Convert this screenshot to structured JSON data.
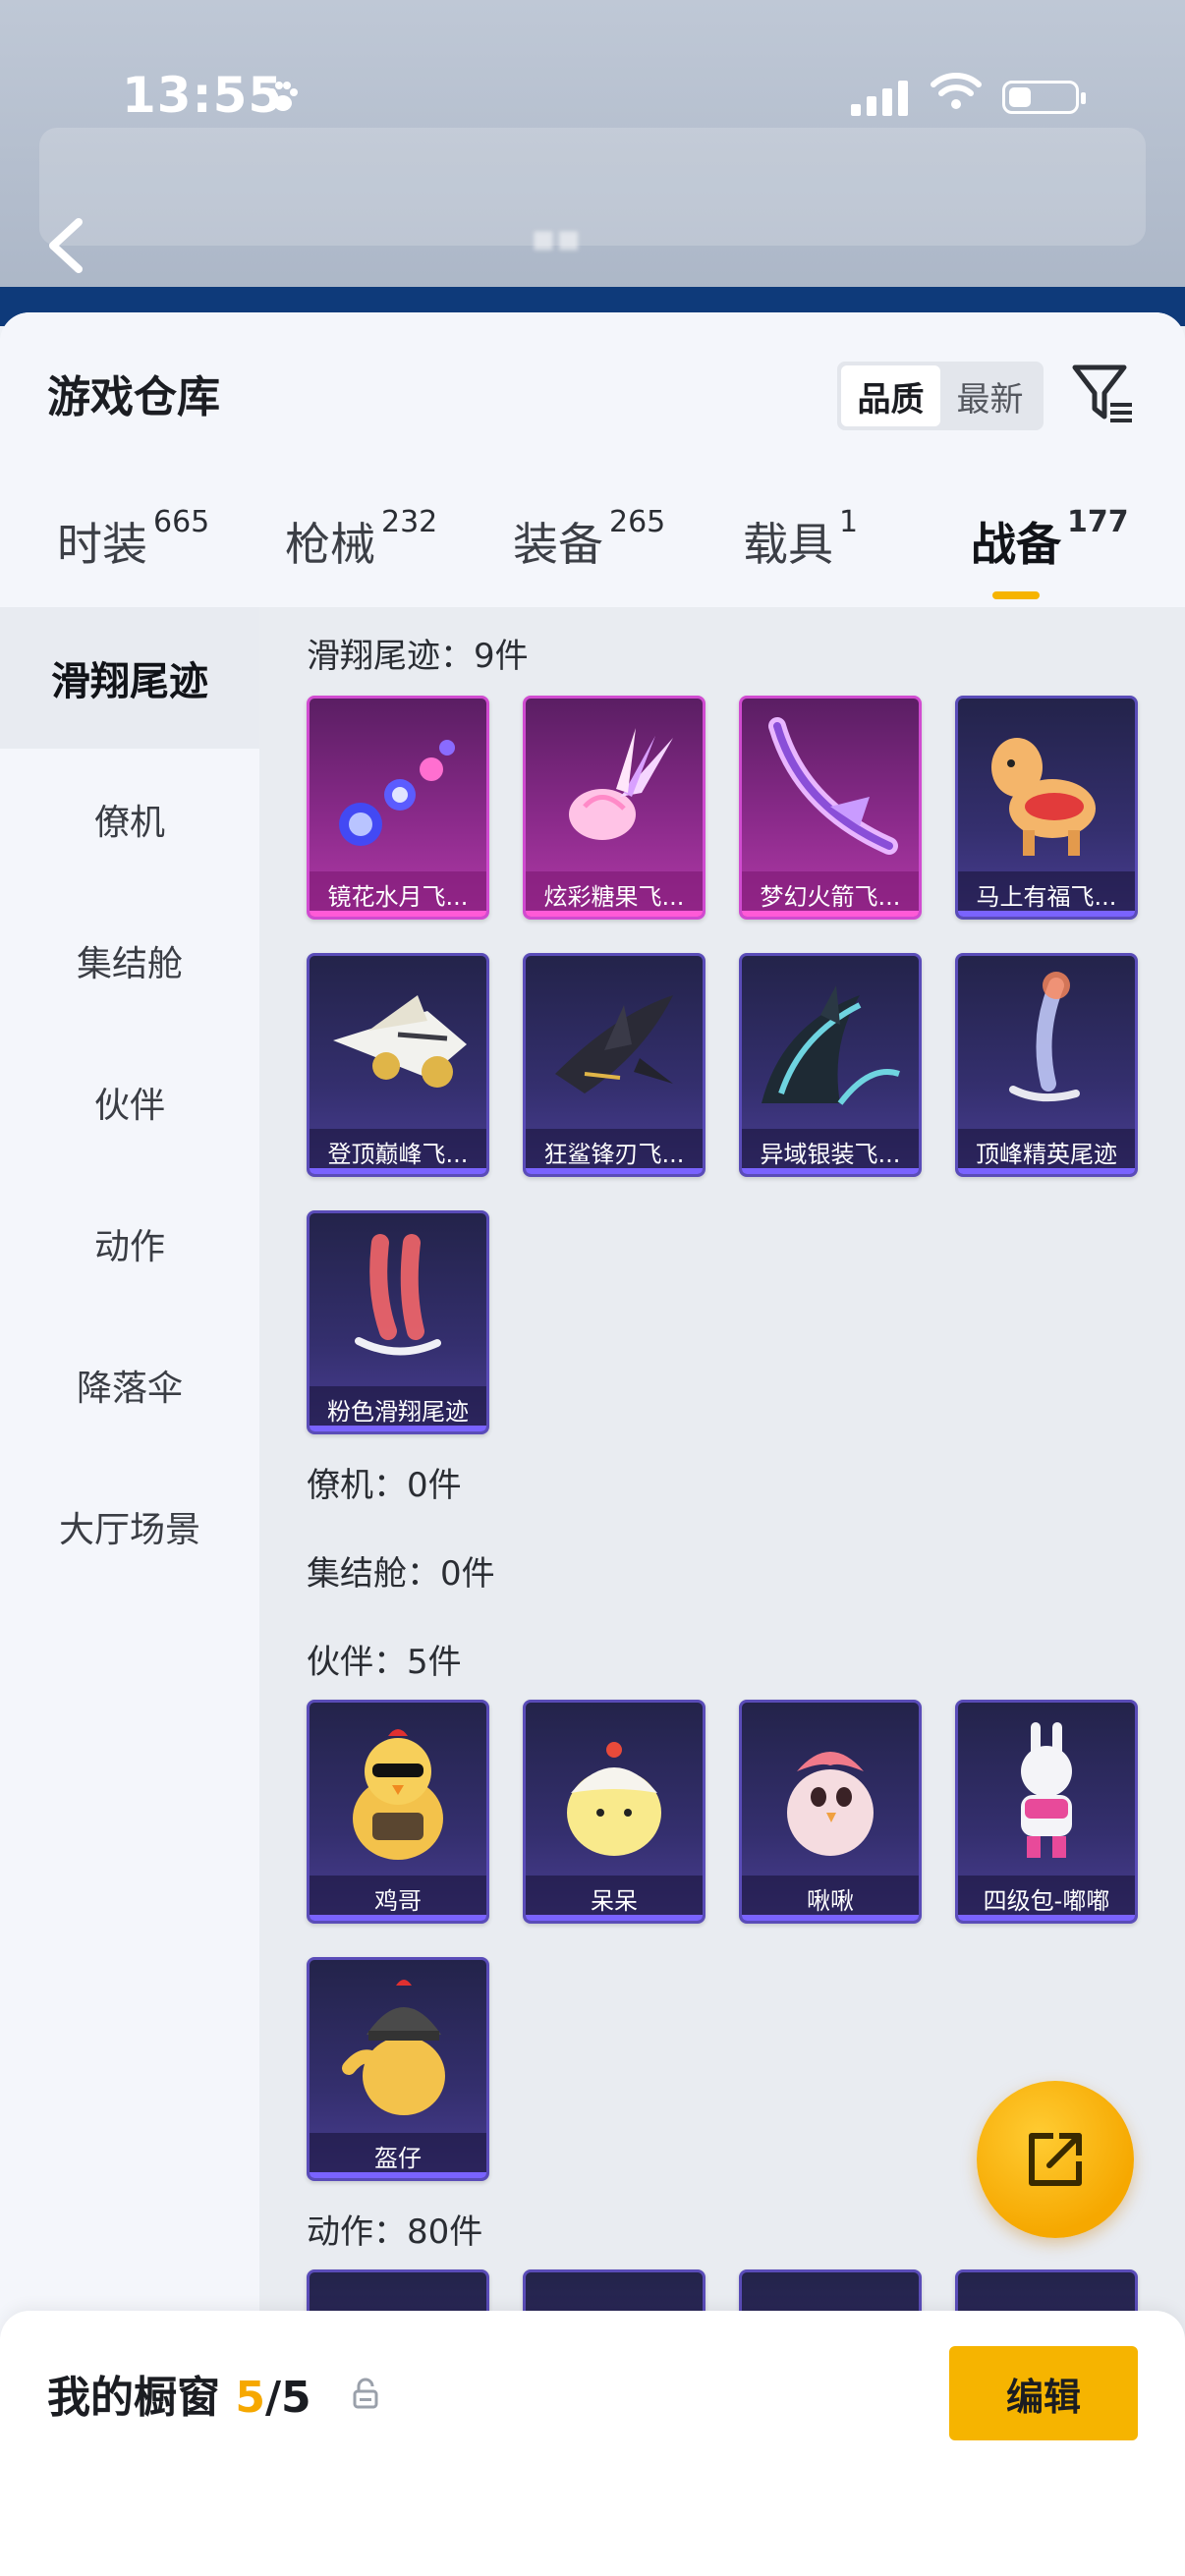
{
  "status_bar": {
    "time": "13:55"
  },
  "header": {
    "title": "游戏仓库",
    "sort_options": [
      "品质",
      "最新"
    ],
    "sort_active": "品质"
  },
  "tabs": [
    {
      "label": "时装",
      "count": "665"
    },
    {
      "label": "枪械",
      "count": "232"
    },
    {
      "label": "装备",
      "count": "265"
    },
    {
      "label": "载具",
      "count": "1"
    },
    {
      "label": "战备",
      "count": "177"
    }
  ],
  "active_tab": "战备",
  "sidenav": {
    "items": [
      "滑翔尾迹",
      "僚机",
      "集结舱",
      "伙伴",
      "动作",
      "降落伞",
      "大厅场景"
    ],
    "active": "滑翔尾迹"
  },
  "sections": {
    "glide": {
      "label": "滑翔尾迹：9件"
    },
    "wingman": {
      "label": "僚机：0件"
    },
    "capsule": {
      "label": "集结舱：0件"
    },
    "partner": {
      "label": "伙伴：5件"
    },
    "action": {
      "label": "动作：80件"
    }
  },
  "glide_items": [
    {
      "name": "镜花水月飞...",
      "icon": "sparkle-orbs-trail-icon"
    },
    {
      "name": "炫彩糖果飞...",
      "icon": "candy-glider-icon"
    },
    {
      "name": "梦幻火箭飞...",
      "icon": "dream-rocket-glider-icon"
    },
    {
      "name": "马上有福飞...",
      "icon": "lucky-horse-glider-icon"
    },
    {
      "name": "登顶巅峰飞...",
      "icon": "summit-jet-glider-icon"
    },
    {
      "name": "狂鲨锋刃飞...",
      "icon": "shark-blade-glider-icon"
    },
    {
      "name": "异域银装飞...",
      "icon": "silver-wing-glider-icon"
    },
    {
      "name": "顶峰精英尾迹",
      "icon": "elite-smoke-trail-icon"
    },
    {
      "name": "粉色滑翔尾迹",
      "icon": "pink-smoke-trail-icon"
    }
  ],
  "partner_items": [
    {
      "name": "鸡哥",
      "icon": "chicken-sunglasses-icon"
    },
    {
      "name": "呆呆",
      "icon": "egg-chick-icon"
    },
    {
      "name": "啾啾",
      "icon": "pink-bird-icon"
    },
    {
      "name": "四级包-嘟嘟",
      "icon": "bunny-robot-icon"
    },
    {
      "name": "盔仔",
      "icon": "helmet-chick-icon"
    }
  ],
  "bottom_bar": {
    "title": "我的橱窗",
    "count_current": "5",
    "count_total": "/5",
    "edit_label": "编辑"
  },
  "colors": {
    "accent": "#f6b400",
    "rare_frame": "#5a4cb8",
    "epic_frame": "#d04bd0"
  }
}
